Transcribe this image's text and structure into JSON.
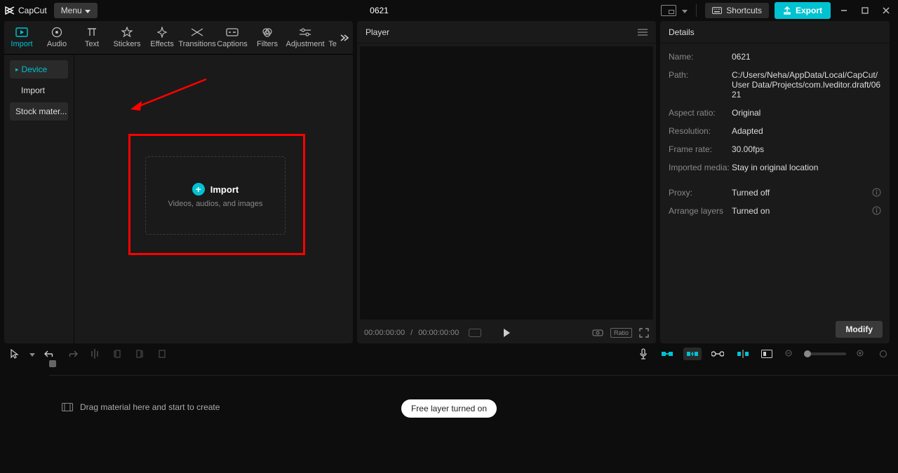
{
  "app": {
    "name": "CapCut"
  },
  "titlebar": {
    "menu": "Menu",
    "project_title": "0621",
    "shortcuts": "Shortcuts",
    "export": "Export"
  },
  "media": {
    "tabs": [
      "Import",
      "Audio",
      "Text",
      "Stickers",
      "Effects",
      "Transitions",
      "Captions",
      "Filters",
      "Adjustment",
      "Te"
    ],
    "side": {
      "device": "Device",
      "import": "Import",
      "stock": "Stock mater..."
    },
    "import_box": {
      "title": "Import",
      "subtitle": "Videos, audios, and images"
    }
  },
  "player": {
    "title": "Player",
    "time_current": "00:00:00:00",
    "time_sep": " / ",
    "time_total": "00:00:00:00",
    "ratio": "Ratio"
  },
  "details": {
    "title": "Details",
    "rows": {
      "name_label": "Name:",
      "name_val": "0621",
      "path_label": "Path:",
      "path_val": "C:/Users/Neha/AppData/Local/CapCut/User Data/Projects/com.lveditor.draft/0621",
      "aspect_label": "Aspect ratio:",
      "aspect_val": "Original",
      "res_label": "Resolution:",
      "res_val": "Adapted",
      "fps_label": "Frame rate:",
      "fps_val": "30.00fps",
      "imported_label": "Imported media:",
      "imported_val": "Stay in original location",
      "proxy_label": "Proxy:",
      "proxy_val": "Turned off",
      "layers_label": "Arrange layers",
      "layers_val": "Turned on"
    },
    "modify": "Modify"
  },
  "toast": {
    "text": "Free layer turned on"
  },
  "timeline": {
    "placeholder": "Drag material here and start to create"
  }
}
